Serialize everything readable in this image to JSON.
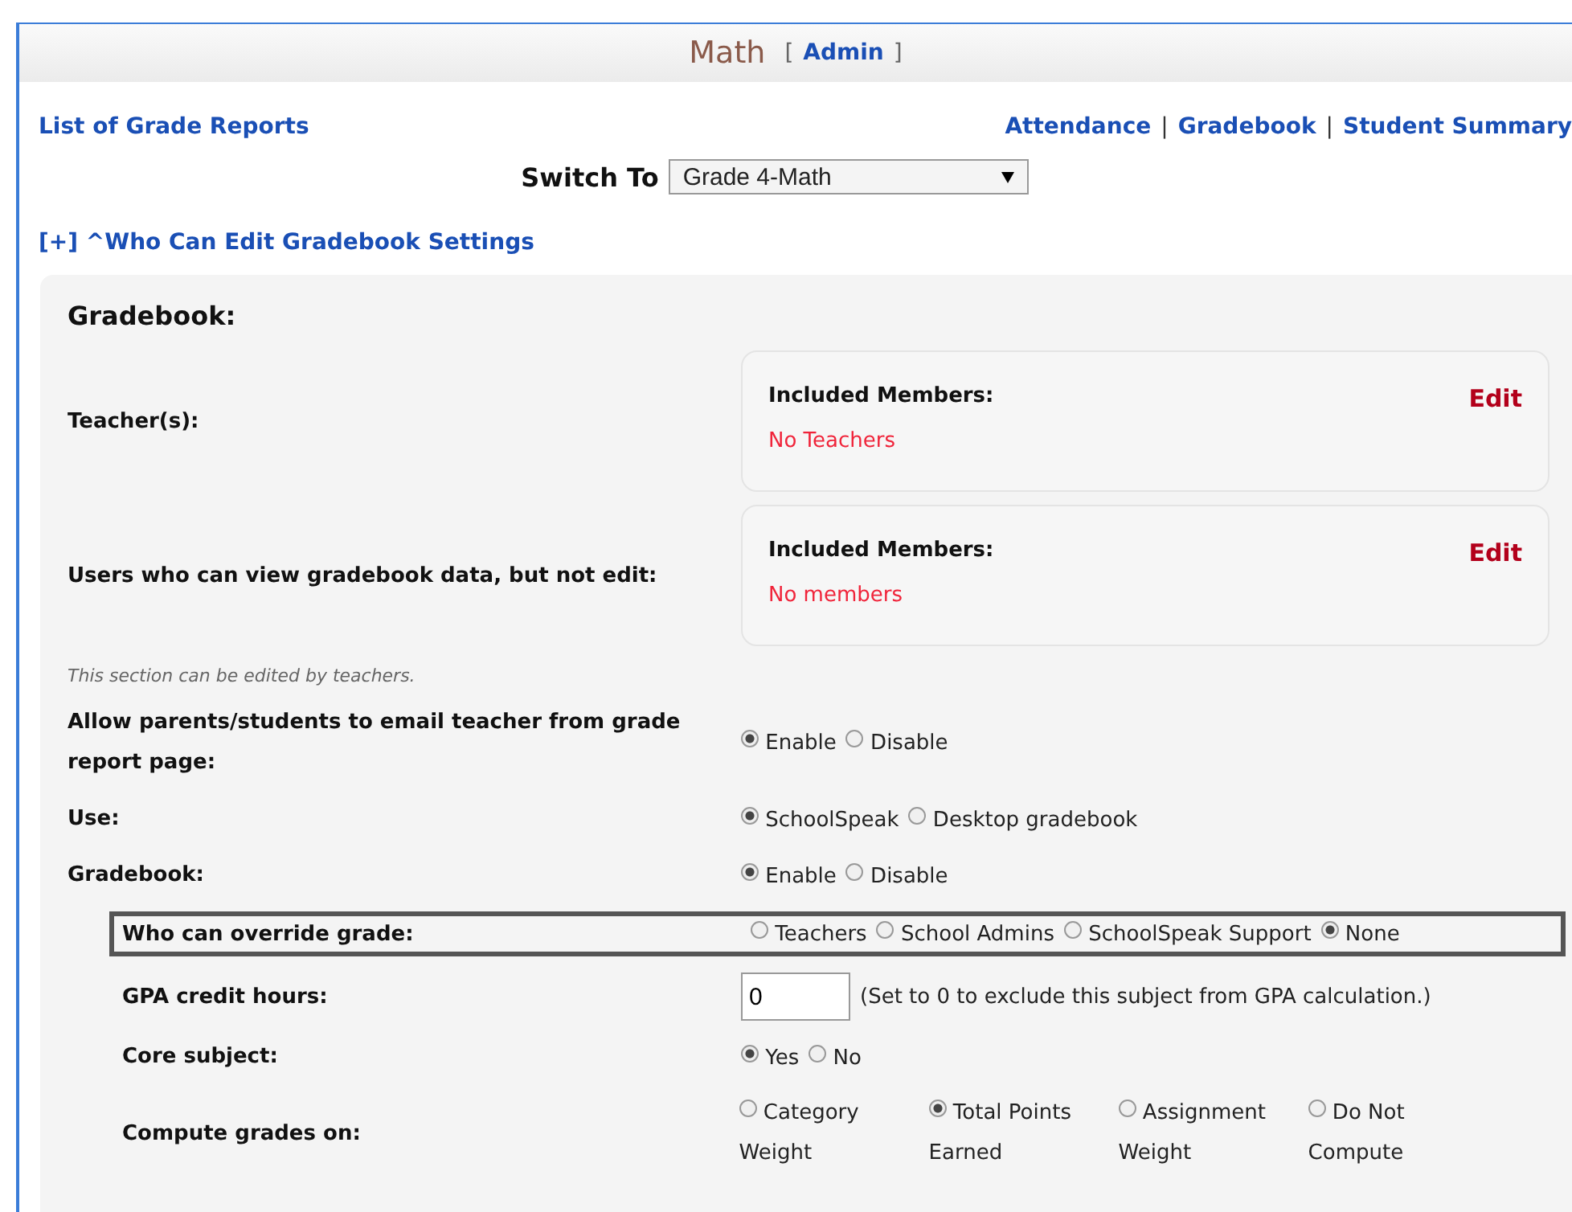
{
  "header": {
    "title": "Math",
    "bracket_open": "[",
    "role_link": "Admin",
    "bracket_close": "]"
  },
  "nav": {
    "left_link": "List of Grade Reports",
    "right_links": [
      "Attendance",
      "Gradebook",
      "Student Summary"
    ],
    "separator": "|"
  },
  "switch_to": {
    "label": "Switch To",
    "value": "Grade 4-Math"
  },
  "toggle_link": "[+] ^Who Can Edit Gradebook Settings",
  "panel": {
    "title": "Gradebook:",
    "members": [
      {
        "label": "Teacher(s):",
        "heading": "Included Members:",
        "edit": "Edit",
        "empty": "No Teachers"
      },
      {
        "label": "Users who can view gradebook data, but not edit:",
        "heading": "Included Members:",
        "edit": "Edit",
        "empty": "No members"
      }
    ],
    "note": "This section can be edited by teachers.",
    "settings": [
      {
        "kind": "radio",
        "label": "Allow parents/students to email teacher from grade report page:",
        "outlined": false,
        "options": [
          {
            "label": "Enable",
            "selected": true
          },
          {
            "label": "Disable",
            "selected": false
          }
        ]
      },
      {
        "kind": "radio",
        "label": "Use:",
        "outlined": false,
        "options": [
          {
            "label": "SchoolSpeak",
            "selected": true
          },
          {
            "label": "Desktop gradebook",
            "selected": false
          }
        ]
      },
      {
        "kind": "radio",
        "label": "Gradebook:",
        "outlined": false,
        "options": [
          {
            "label": "Enable",
            "selected": true
          },
          {
            "label": "Disable",
            "selected": false
          }
        ],
        "children": [
          {
            "kind": "radio",
            "label": "Who can override grade:",
            "outlined": true,
            "options": [
              {
                "label": "Teachers",
                "selected": false
              },
              {
                "label": "School Admins",
                "selected": false
              },
              {
                "label": "SchoolSpeak Support",
                "selected": false
              },
              {
                "label": "None",
                "selected": true
              }
            ]
          },
          {
            "kind": "input",
            "label": "GPA credit hours:",
            "outlined": false,
            "value": "0",
            "hint": "(Set to 0 to exclude this subject from GPA calculation.)"
          },
          {
            "kind": "radio",
            "label": "Core subject:",
            "outlined": false,
            "options": [
              {
                "label": "Yes",
                "selected": true
              },
              {
                "label": "No",
                "selected": false
              }
            ]
          },
          {
            "kind": "grid",
            "label": "Compute grades on:",
            "outlined": false,
            "options": [
              {
                "label": "Category Weight",
                "selected": false
              },
              {
                "label": "Total Points Earned",
                "selected": true
              },
              {
                "label": "Assignment Weight",
                "selected": false
              },
              {
                "label": "Do Not Compute",
                "selected": false
              }
            ]
          }
        ]
      }
    ]
  }
}
